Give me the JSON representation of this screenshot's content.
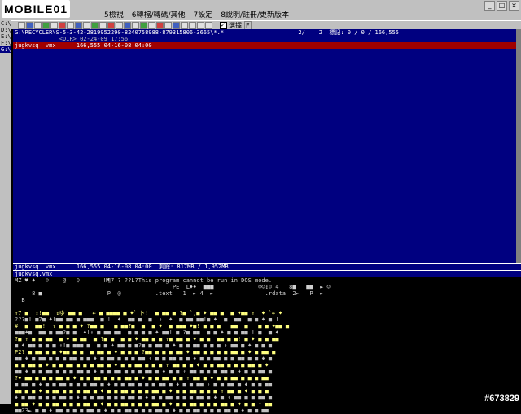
{
  "logo": "MOBILE01",
  "menu": [
    "5檢視",
    "6轉檔/轉碼/其他",
    "7設定",
    "8說明/註冊/更新版本"
  ],
  "toolbar_check_label": "選擇",
  "toolbar_f_label": "F",
  "drives": [
    "C:\\",
    "D:\\",
    "E:\\",
    "F:\\",
    "G:\\"
  ],
  "selected_drive": 4,
  "panel_top": {
    "path": "G:\\RECYCLER\\S-5-3-42-2819952290-8240758988-879315806-3665\\*.*",
    "counts": "2/    2  標記: 0 / 0 / 166,555",
    "dir_row": {
      "name": "<DIR>",
      "date": "02-24-09 17:56"
    },
    "file_row": {
      "name": "jugkvsq  vmx",
      "size": "166,555",
      "date": "04-16-08 04:00"
    }
  },
  "status_bar": "jugkvsq  vmx      166,555 04-16-08 04:00  剩餘: 817MB / 1,952MB",
  "viewer_file": "jugkvsq.vmx",
  "viewer_header": "MZ ♥ ♦   ☺    @   ♀       ‼¶7 ? ??L?This program cannot be run in DOS mode.",
  "viewer_row2": "                                              PE  L♦♦  ■■■             ☺☺↕☺ 4   8■   ■■  ► ☺",
  "viewer_row3": "     8 ■                   P  @          .text   1  ► 4  ►               .rdata  2►   P  ►",
  "viewer_row4": "  B",
  "noise_lines": [
    "↑7 ■  ↕!■■  ↕ゆ ■■ ■   ← ■ ■■■■ ■ ♦゛ト!  ■ ■■ ■ ?■ `,■ ♦ ■■ ■  ■ ♦■■ ↑  ♦ `← ♦",
    "???■! ■7■ ♦!■■ ■■ ■ ■■■  ■ !  ♦  ■■ ■  ■  ↑  ♦  ■ ■■ ■■!■ ♦  ■  ■■  ■ ■ ♦ ■ !",
    "#' ■  ■■!  ↑ ■ ■ ■ ♦ ?■■ ■   ■ ■■?■  ■  ■ ♦  ■ ■■■ ♦■! ■ ■ ■   ■■  ■   ■ ■ ♦■■ ■",
    "■■■♦■  ■■ ■ ■■?■ ■  ♦!↑ ■ ■■ ■■  ■ ■ ■ ■ ♦ ■■! ■ ?■ ■■  ■ ■ ♦ ■ ■ ■■ ! ■  ■ ♦",
    "?■ ↑ ■!■ ■■  ■ ♦ ■ ■■  ■ ?■ ■  ■ ■ ♦ ■■ ■ ■ ↑■ ■■ ■ ♦ ■ ■  ■■ ■ ■! ■ ♦ ■ ■ ■■",
    "■ ♦ ■■ ■ ■ ■ ↑!■ ■■■ ■  ■ ■ ♦ ■■ ■ ■?■ ■ ■■ ■ ♦ ■ ■ ■■ ■ ■ ■ ↑ ■■ ■ ♦ ■ ■ ■",
    "P2? ■ ■■ ■ ■ ♦■■ ■ ■  ■ ■■ ■ ♦ ■ ■ ■ ?■■ ■ ■ ■ ■■ ♦ ■■ ■ ■ ■ ■ ■■ ■ ♦ ■ ■■ ■",
    "■■ ♦ ■ ■■ ■ ■ ■ ■■ ■ ■ ♦ ■ ■■ ■ ■ ■ ■■ ↑ ■ ■ ■■ ■ ■ ♦ ■ ■ ■■ ■ ■ ■■ ■ ■ ♦ ■",
    "■ ■ ■■ ■ ♦ ■ ■ ■■ ■ ■ ■ ■■ ■ ♦ ■ ■ ■■ ■ ■ ■ ↑ ■■ ■ ■ ♦ ■ ■ ■■ ■ ■ ■ ■■ ■ ♦",
    "■■ ♦ ■ ■ ■■ ■ ■ ■ ■■ ■ ♦ ■ ■ ■■ ■ ■ ■ ■■ ■ ♦ ■ ■ ↑ ■■ ■ ■ ■ ■■ ■ ♦ ■ ■ ■■ ■",
    "?♦ ■■ ■ ■ ■ ■■ ■ ♦ ■ ■ ■■ ■ ■ ■ ■■ ■ ♦ ■ ■ ■■ ■ ■ ↑ ■■ ■ ♦ ■ ■ ■■ ■ ■ ■ ■■",
    "■ ■■ ■ ♦ ■ ■ ■■ ■ ■ ■ ■■ ■ ♦ ■ ■ ■■ ■ ■ ■ ■■ ■ ♦ ■ ■ ■■ ↑ ■ ■ ■■ ■ ♦ ■ ■ ■■",
    "■■ ■ ■ ♦ ■ ■■ ■ ■ ■ ■■ ■ ♦ ■ ■ ■■ ■ ■ ■ ■■ ■ ♦ ■ ■ ■■ ■ ■ ■ ↑ ■■ ■ ♦ ■ ■ ■",
    "♦ ■ ■■ ■ ■ ■ ■■ ■ ♦ ■ ■ ■■ ■ ■ ■ ■■ ■ ♦ ■ ■ ■■ ■ ■ ■ ■■ ■ ♦ ■ ↑ ■■ ■ ■ ■■ ■",
    "■ ■■ ♦ ■ ■ ■■ ■ ■ ■ ■■ ■ ♦ ■ ■ ■■ ■ ■ ■ ■■ ■ ♦ ■ ■ ■■ ■ ■ ■ ■■ ■ ♦ ■ ■ ↑ ■■",
    "■■Z3► ■ ■ ♦ ■■ ■ ■ ■ ■■ ■ ♦ ■ ■ ■■ ■ ■ ■ ■■ ■ ♦ ■ ■ ■■ ■ ■ ■ ■■ ■ ♦ ■ ■ ■■"
  ],
  "watermark": "#673829"
}
